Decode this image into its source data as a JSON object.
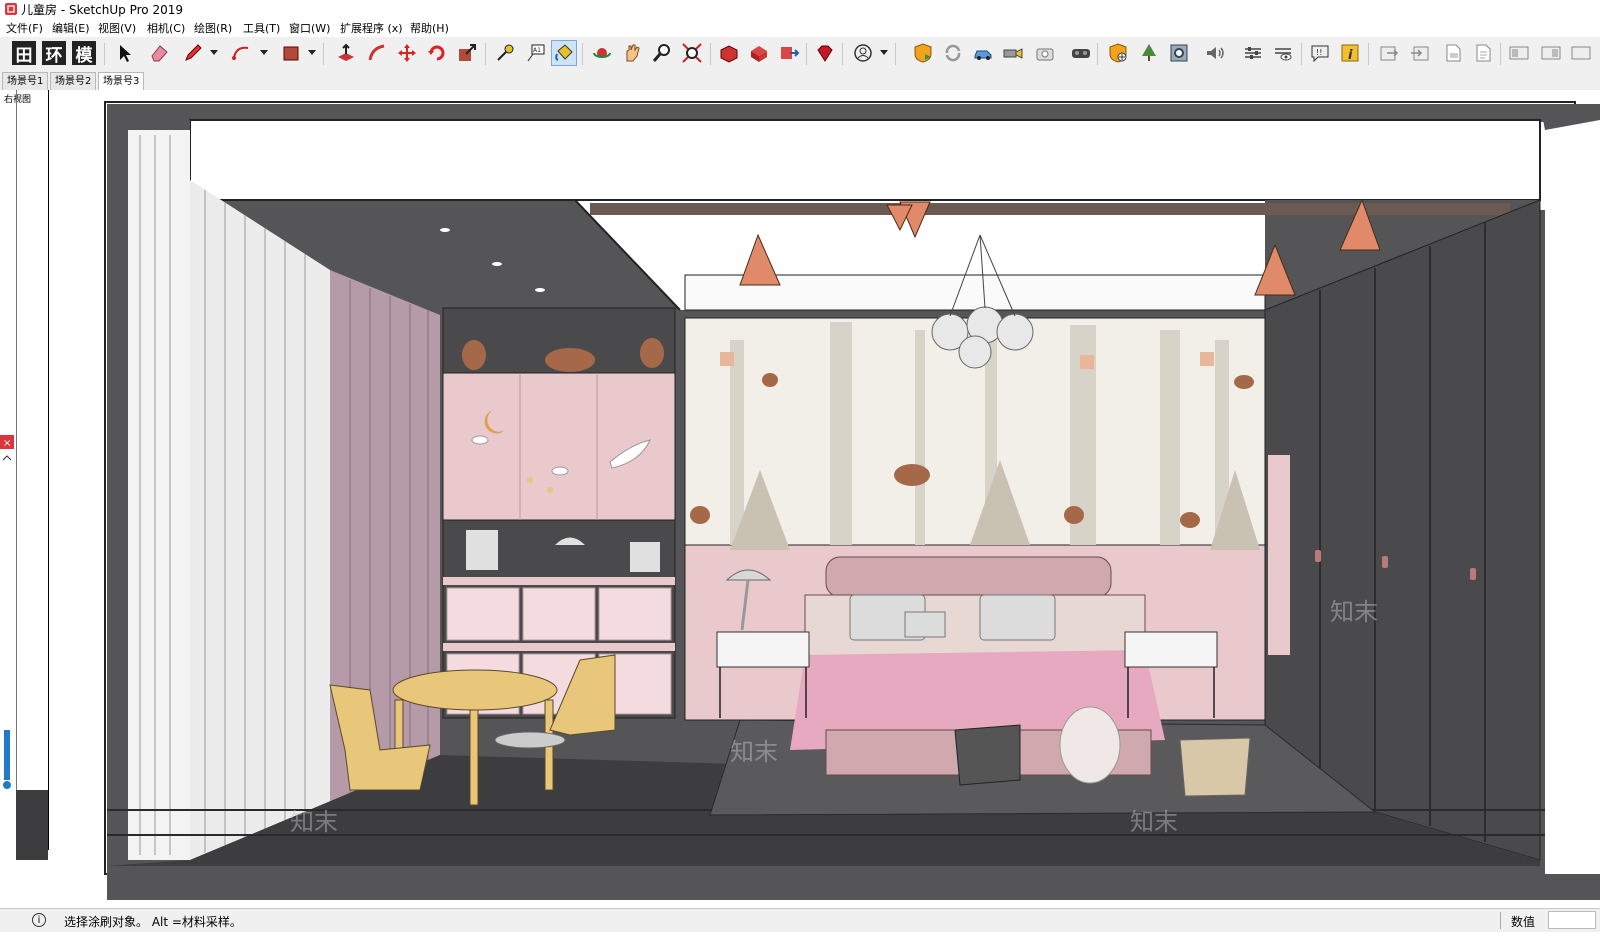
{
  "window": {
    "title": "儿童房 - SketchUp Pro 2019"
  },
  "menu": [
    {
      "label": "文件(F)"
    },
    {
      "label": "编辑(E)"
    },
    {
      "label": "视图(V)"
    },
    {
      "label": "相机(C)"
    },
    {
      "label": "绘图(R)"
    },
    {
      "label": "工具(T)"
    },
    {
      "label": "窗口(W)"
    },
    {
      "label": "扩展程序 (x)"
    },
    {
      "label": "帮助(H)"
    }
  ],
  "toolbar": {
    "text_buttons": [
      {
        "label": "田"
      },
      {
        "label": "环"
      },
      {
        "label": "模"
      }
    ],
    "icons": [
      "select-arrow-icon",
      "eraser-icon",
      "pencil-icon",
      "arc-icon",
      "rectangle-icon",
      "push-pull-icon",
      "follow-me-icon",
      "move-icon",
      "rotate-icon",
      "scale-icon",
      "tape-measure-icon",
      "text-label-icon",
      "paint-bucket-icon",
      "orbit-icon",
      "pan-icon",
      "zoom-icon",
      "zoom-extents-icon",
      "warehouse-icon",
      "extension-warehouse-icon",
      "send-to-layout-icon",
      "ruby-console-icon",
      "account-icon",
      "shield-play-icon",
      "refresh-icon",
      "car-icon",
      "projector-icon",
      "camera-icon",
      "vr-headset-icon",
      "shield-add-icon",
      "tree-icon",
      "gear-icon",
      "speaker-icon",
      "sliders-icon",
      "eye-settings-icon",
      "chat-icon",
      "info-icon",
      "export-icon",
      "import-icon",
      "pdf-icon",
      "document-icon",
      "panel-icon",
      "layers-icon"
    ]
  },
  "scene_tabs": [
    {
      "label": "场景号1"
    },
    {
      "label": "场景号2"
    },
    {
      "label": "场景号3",
      "active": true
    }
  ],
  "viewport": {
    "view_label": "右视图",
    "watermark": "知末"
  },
  "statusbar": {
    "hint": "选择涂刷对象。 Alt =材料采样。",
    "measurement_label": "数值",
    "measurement_value": ""
  },
  "colors": {
    "ceiling_dark": "#555558",
    "wall_pink": "#e9c9cc",
    "floor_dark": "#3d3c3e",
    "cabinet_dark": "#4a4a4c",
    "curtain_white": "#f3f3f3",
    "curtain_pink": "#b59aa8",
    "accent_copper": "#e08a6a",
    "wood_yellow": "#e8c77b"
  }
}
